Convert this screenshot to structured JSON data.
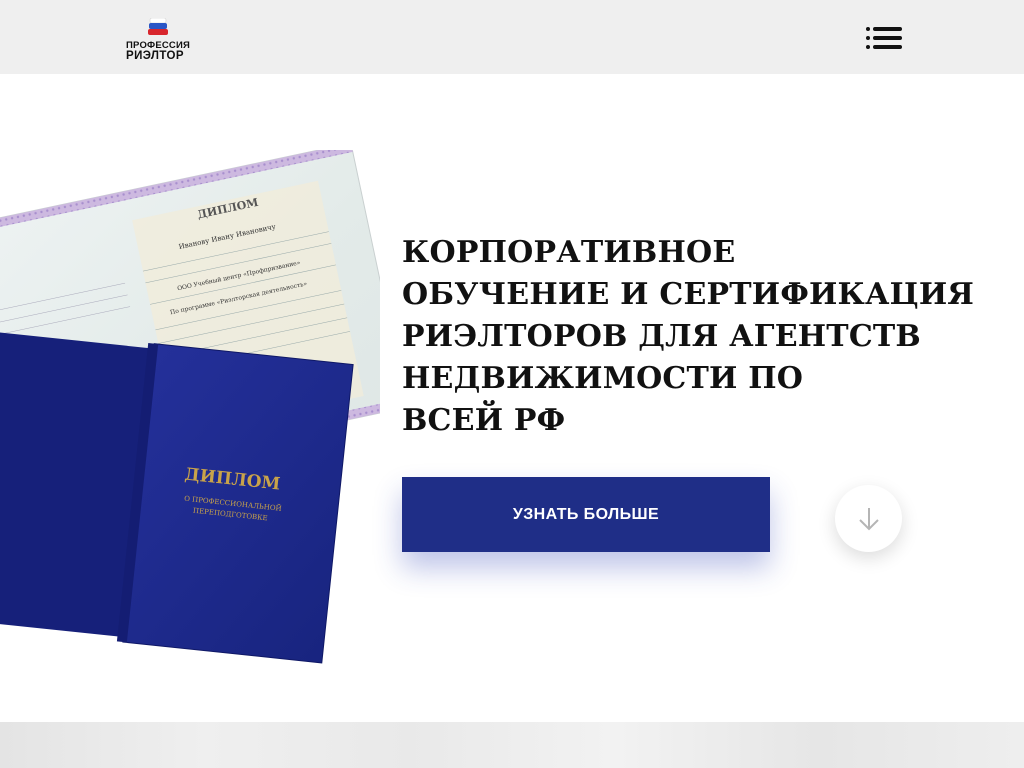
{
  "header": {
    "logo": {
      "line1": "ПРОФЕССИЯ",
      "line2": "РИЭЛТОР",
      "icon": "flag-icon"
    },
    "menu_icon": "hamburger-menu-icon"
  },
  "illustration": {
    "diploma_heading": "ДИПЛОМ",
    "cover_title": "ДИПЛОМ",
    "cover_subtitle_line1": "О ПРОФЕССИОНАЛЬНОЙ",
    "cover_subtitle_line2": "ПЕРЕПОДГОТОВКЕ",
    "sheet_name": "Иванову Ивану Ивановичу",
    "sheet_org": "ООО Учебный центр «Профпризвание»",
    "sheet_program": "По программе «Риэлторская деятельность»"
  },
  "hero": {
    "headline_lines": [
      "КОРПОРАТИВНОЕ",
      "ОБУЧЕНИЕ И СЕРТИФИКАЦИЯ",
      "РИЭЛТОРОВ ДЛЯ АГЕНТСТВ",
      "НЕДВИЖИМОСТИ ПО",
      "ВСЕЙ РФ"
    ],
    "cta_label": "УЗНАТЬ БОЛЬШЕ",
    "scroll_icon": "arrow-down-icon"
  },
  "colors": {
    "header_bg": "#efefef",
    "cta_bg": "#1f2e87",
    "cover_blue": "#1d2a8f",
    "gold": "#c9a34a"
  }
}
